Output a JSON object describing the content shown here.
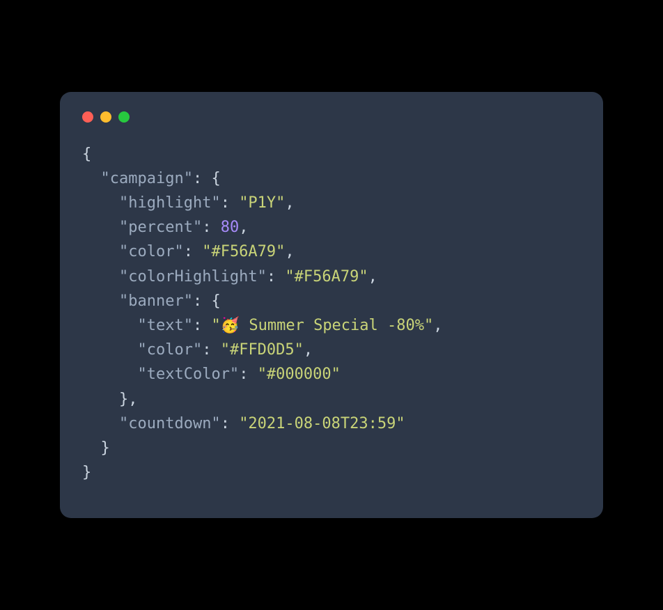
{
  "code": {
    "line1": "{",
    "line2_indent": "  ",
    "line2_key": "\"campaign\"",
    "line2_end": ": {",
    "line3_indent": "    ",
    "line3_key": "\"highlight\"",
    "line3_colon": ": ",
    "line3_val": "\"P1Y\"",
    "line3_end": ",",
    "line4_indent": "    ",
    "line4_key": "\"percent\"",
    "line4_colon": ": ",
    "line4_val": "80",
    "line4_end": ",",
    "line5_indent": "    ",
    "line5_key": "\"color\"",
    "line5_colon": ": ",
    "line5_val": "\"#F56A79\"",
    "line5_end": ",",
    "line6_indent": "    ",
    "line6_key": "\"colorHighlight\"",
    "line6_colon": ": ",
    "line6_val": "\"#F56A79\"",
    "line6_end": ",",
    "line7_indent": "    ",
    "line7_key": "\"banner\"",
    "line7_end": ": {",
    "line8_indent": "      ",
    "line8_key": "\"text\"",
    "line8_colon": ": ",
    "line8_val": "\"🥳 Summer Special -80%\"",
    "line8_end": ",",
    "line9_indent": "      ",
    "line9_key": "\"color\"",
    "line9_colon": ": ",
    "line9_val": "\"#FFD0D5\"",
    "line9_end": ",",
    "line10_indent": "      ",
    "line10_key": "\"textColor\"",
    "line10_colon": ": ",
    "line10_val": "\"#000000\"",
    "line11_indent": "    ",
    "line11": "},",
    "line12_indent": "    ",
    "line12_key": "\"countdown\"",
    "line12_colon": ": ",
    "line12_val": "\"2021-08-08T23:59\"",
    "line13_indent": "  ",
    "line13": "}",
    "line14": "}"
  }
}
